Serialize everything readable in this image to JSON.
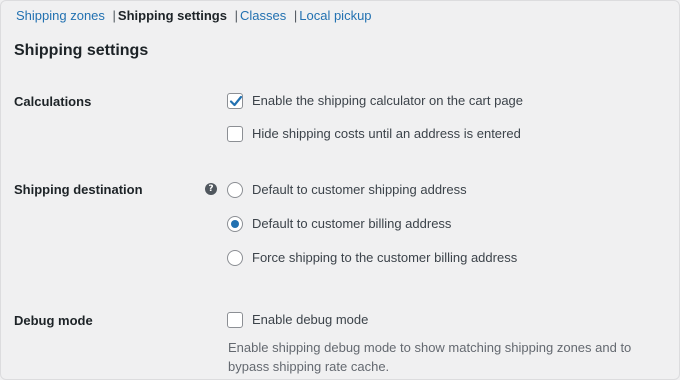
{
  "nav": {
    "links": [
      {
        "label": "Shipping zones"
      },
      {
        "label": "Shipping settings"
      },
      {
        "label": "Classes"
      },
      {
        "label": "Local pickup"
      }
    ],
    "separator": "|"
  },
  "page_title": "Shipping settings",
  "calculations": {
    "label": "Calculations",
    "options": [
      {
        "label": "Enable the shipping calculator on the cart page",
        "checked": true
      },
      {
        "label": "Hide shipping costs until an address is entered",
        "checked": false
      }
    ]
  },
  "destination": {
    "label": "Shipping destination",
    "help_icon": "question-circle-icon",
    "help_glyph": "?",
    "options": [
      {
        "label": "Default to customer shipping address",
        "selected": false
      },
      {
        "label": "Default to customer billing address",
        "selected": true
      },
      {
        "label": "Force shipping to the customer billing address",
        "selected": false
      }
    ]
  },
  "debug": {
    "label": "Debug mode",
    "option": {
      "label": "Enable debug mode",
      "checked": false
    },
    "description": "Enable shipping debug mode to show matching shipping zones and to bypass shipping rate cache."
  },
  "colors": {
    "accent": "#2271b1",
    "background": "#f0f0f1",
    "text": "#1d2327"
  }
}
